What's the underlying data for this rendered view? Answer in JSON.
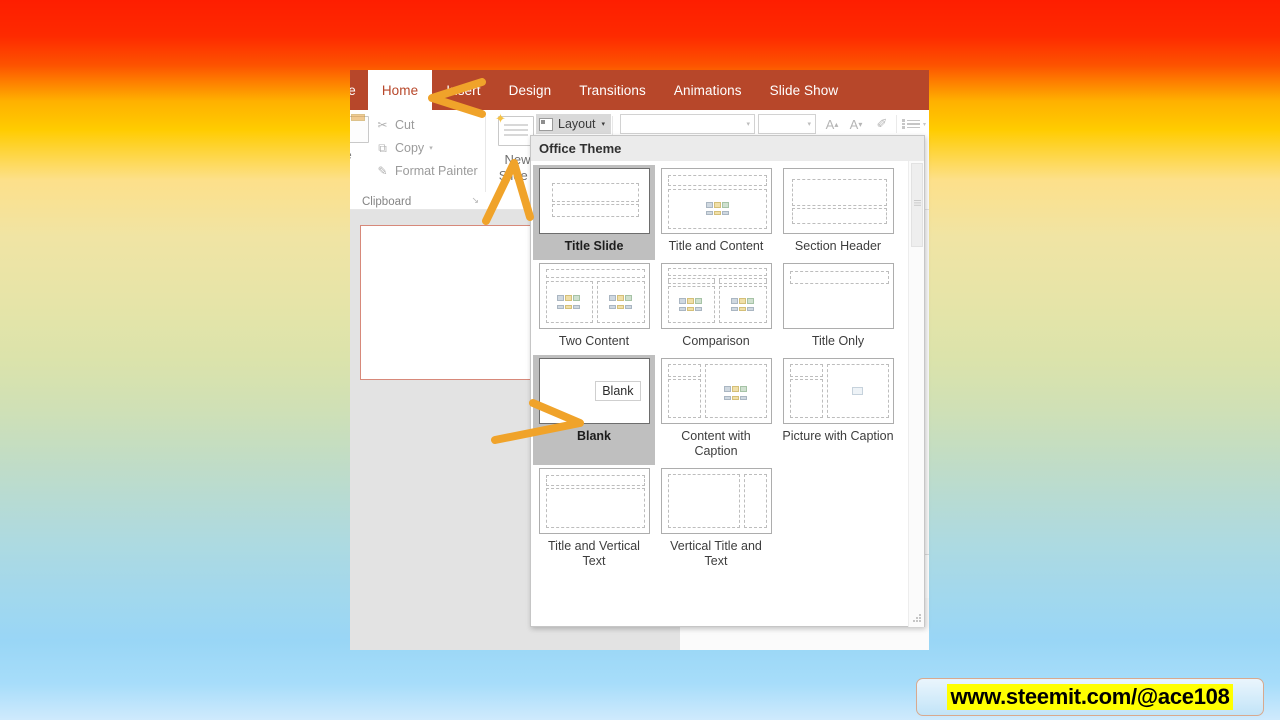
{
  "app": {
    "ribbon_color": "#b7472a",
    "tabs": [
      {
        "label": "ile",
        "active": false
      },
      {
        "label": "Home",
        "active": true
      },
      {
        "label": "Insert",
        "active": false
      },
      {
        "label": "Design",
        "active": false
      },
      {
        "label": "Transitions",
        "active": false
      },
      {
        "label": "Animations",
        "active": false
      },
      {
        "label": "Slide Show",
        "active": false
      }
    ]
  },
  "ribbon": {
    "clipboard": {
      "paste_label": "te",
      "items": [
        {
          "label": "Cut",
          "icon": "scissors-icon",
          "glyph": "✂",
          "caret": false
        },
        {
          "label": "Copy",
          "icon": "copy-icon",
          "glyph": "⧉",
          "caret": true
        },
        {
          "label": "Format Painter",
          "icon": "paintbrush-icon",
          "glyph": "✎",
          "caret": false
        }
      ],
      "group_title": "Clipboard",
      "launcher": "↘"
    },
    "slides": {
      "new_slide_line1": "New",
      "new_slide_line2": "Slide",
      "new_slide_caret": "▾",
      "layout_label": "Layout",
      "layout_caret": "▾"
    },
    "font": {
      "font_name_value": "",
      "font_size_value": "",
      "grow_font": "A",
      "grow_font_sup": "▴",
      "shrink_font": "A",
      "shrink_font_sup": "▾",
      "clear_formatting": "✐"
    }
  },
  "layout_gallery": {
    "header": "Office Theme",
    "items": [
      {
        "label": "Title Slide",
        "selected": true,
        "kind": "title-slide"
      },
      {
        "label": "Title and Content",
        "selected": false,
        "kind": "title-and-content"
      },
      {
        "label": "Section Header",
        "selected": false,
        "kind": "section-header"
      },
      {
        "label": "Two Content",
        "selected": false,
        "kind": "two-content"
      },
      {
        "label": "Comparison",
        "selected": false,
        "kind": "comparison"
      },
      {
        "label": "Title Only",
        "selected": false,
        "kind": "title-only"
      },
      {
        "label": "Blank",
        "selected": true,
        "kind": "blank",
        "chip": "Blank"
      },
      {
        "label": "Content with Caption",
        "selected": false,
        "kind": "content-with-caption"
      },
      {
        "label": "Picture with Caption",
        "selected": false,
        "kind": "picture-with-caption"
      },
      {
        "label": "Title and Vertical Text",
        "selected": false,
        "kind": "title-and-vertical-text"
      },
      {
        "label": "Vertical Title and Text",
        "selected": false,
        "kind": "vertical-title-and-text"
      }
    ]
  },
  "annotations": {
    "arrow_color": "#f0a32a",
    "arrow_home": "arrow pointing left to Home tab",
    "arrow_new_slide": "arrow pointing up to New Slide",
    "arrow_blank": "arrow pointing right to Blank layout"
  },
  "watermark": {
    "text": "www.steemit.com/@ace108",
    "highlight_color": "#ffff00"
  }
}
